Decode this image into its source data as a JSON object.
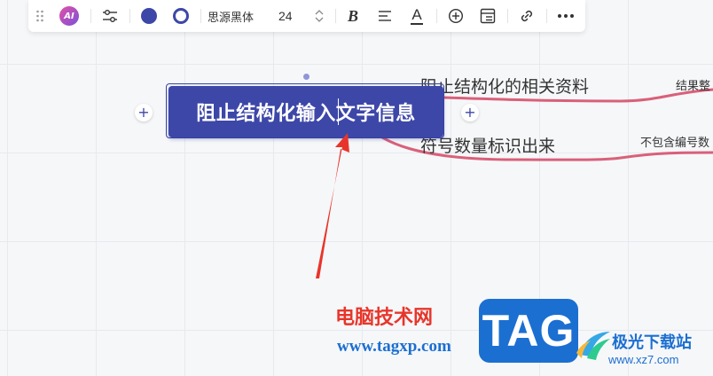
{
  "toolbar": {
    "ai_label": "AI",
    "font_name": "思源黑体",
    "font_size": "24",
    "bold_label": "B",
    "font_color_label": "A"
  },
  "mindmap": {
    "root": "阻止结构化输入文字信息",
    "children": [
      {
        "label": "阻止结构化的相关资料",
        "grandchild": "结果整"
      },
      {
        "label": "符号数量标识出来",
        "grandchild": "不包含编号数"
      }
    ]
  },
  "watermark": {
    "site_name": "电脑技术网",
    "site_url": "www.tagxp.com",
    "tag_label": "TAG",
    "xz_name": "极光下载站",
    "xz_url": "www.xz7.com"
  },
  "colors": {
    "node_fill": "#3d47a8",
    "branch_line": "#d9607a",
    "arrow": "#e8352a",
    "watermark_red": "#e8352a",
    "watermark_blue": "#1b6fd1",
    "accent": "#3d47a8",
    "toolbar_bg": "#ffffff",
    "canvas_bg": "#f6f7f9"
  },
  "icons": {
    "drag": "drag-handle-icon",
    "style": "sliders-icon",
    "fill": "fill-color-icon",
    "border": "border-color-icon",
    "stepper": "stepper-icon",
    "bold": "bold-icon",
    "align": "align-icon",
    "font_color": "font-color-icon",
    "add": "add-circle-icon",
    "outline": "outline-icon",
    "link": "link-icon",
    "more": "more-icon"
  }
}
